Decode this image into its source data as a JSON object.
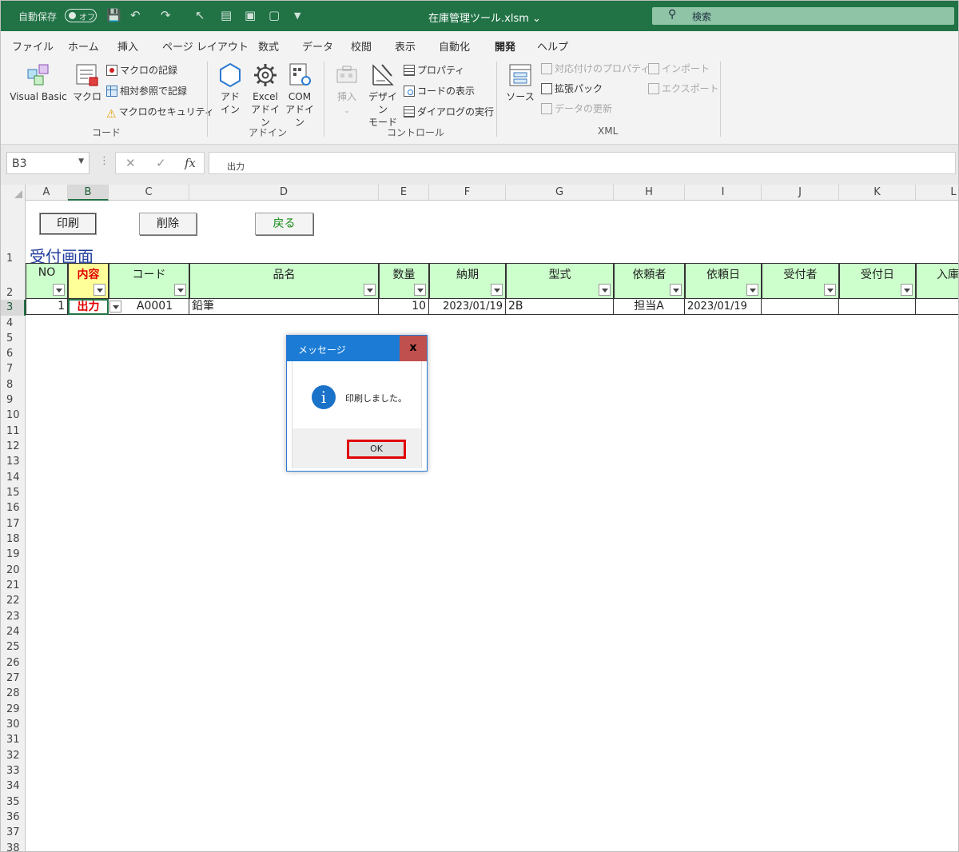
{
  "titlebar": {
    "autosave": "自動保存",
    "toggle_state": "オフ",
    "filename": "在庫管理ツール.xlsm",
    "search": "検索"
  },
  "tabs": [
    "ファイル",
    "ホーム",
    "挿入",
    "ページ レイアウト",
    "数式",
    "データ",
    "校閲",
    "表示",
    "自動化",
    "開発",
    "ヘルプ"
  ],
  "active_tab": "開発",
  "ribbon": {
    "code": {
      "label": "コード",
      "visual_basic": "Visual Basic",
      "macro": "マクロ",
      "record_macro": "マクロの記録",
      "relative_ref": "相対参照で記録",
      "macro_security": "マクロのセキュリティ"
    },
    "addins": {
      "label": "アドイン",
      "addin_l1": "アド",
      "addin_l2": "イン",
      "excel_l1": "Excel",
      "excel_l2": "アドイン",
      "com_l1": "COM",
      "com_l2": "アドイン"
    },
    "controls": {
      "label": "コントロール",
      "insert": "挿入",
      "design_l1": "デザイン",
      "design_l2": "モード",
      "properties": "プロパティ",
      "view_code": "コードの表示",
      "run_dialog": "ダイアログの実行"
    },
    "xml": {
      "label": "XML",
      "source": "ソース",
      "map_properties": "対応付けのプロパティ",
      "expansion_packs": "拡張パック",
      "refresh_data": "データの更新",
      "import": "インポート",
      "export": "エクスポート"
    }
  },
  "formula_bar": {
    "name_box": "B3",
    "value": "出力"
  },
  "columns": [
    "A",
    "B",
    "C",
    "D",
    "E",
    "F",
    "G",
    "H",
    "I",
    "J",
    "K",
    "L"
  ],
  "selected_column": "B",
  "rows": [
    "1",
    "2",
    "3",
    "4",
    "5",
    "6",
    "7",
    "8",
    "9",
    "10",
    "11",
    "12",
    "13",
    "14",
    "15",
    "16",
    "17",
    "18",
    "19",
    "20",
    "21",
    "22",
    "23",
    "24",
    "25",
    "26",
    "27",
    "28",
    "29",
    "30",
    "31",
    "32",
    "33",
    "34",
    "35",
    "36",
    "37",
    "38"
  ],
  "selected_row": "3",
  "sheet_buttons": {
    "print": "印刷",
    "delete": "削除",
    "back": "戻る"
  },
  "sheet_title": "受付画面",
  "table": {
    "headers": [
      "NO",
      "内容",
      "コード",
      "品名",
      "数量",
      "納期",
      "型式",
      "依頼者",
      "依頼日",
      "受付者",
      "受付日",
      "入庫"
    ],
    "row": [
      "1",
      "出力",
      "A0001",
      "鉛筆",
      "10",
      "2023/01/19",
      "2B",
      "担当A",
      "2023/01/19",
      "",
      "",
      ""
    ]
  },
  "dialog": {
    "title": "メッセージ",
    "close": "x",
    "message": "印刷しました。",
    "ok": "OK"
  },
  "colors": {
    "excel_green": "#217346",
    "header_green": "#ccffcc",
    "header_yellow": "#ffff99",
    "dialog_blue": "#1c7cd5",
    "highlight_red": "#e00000"
  }
}
